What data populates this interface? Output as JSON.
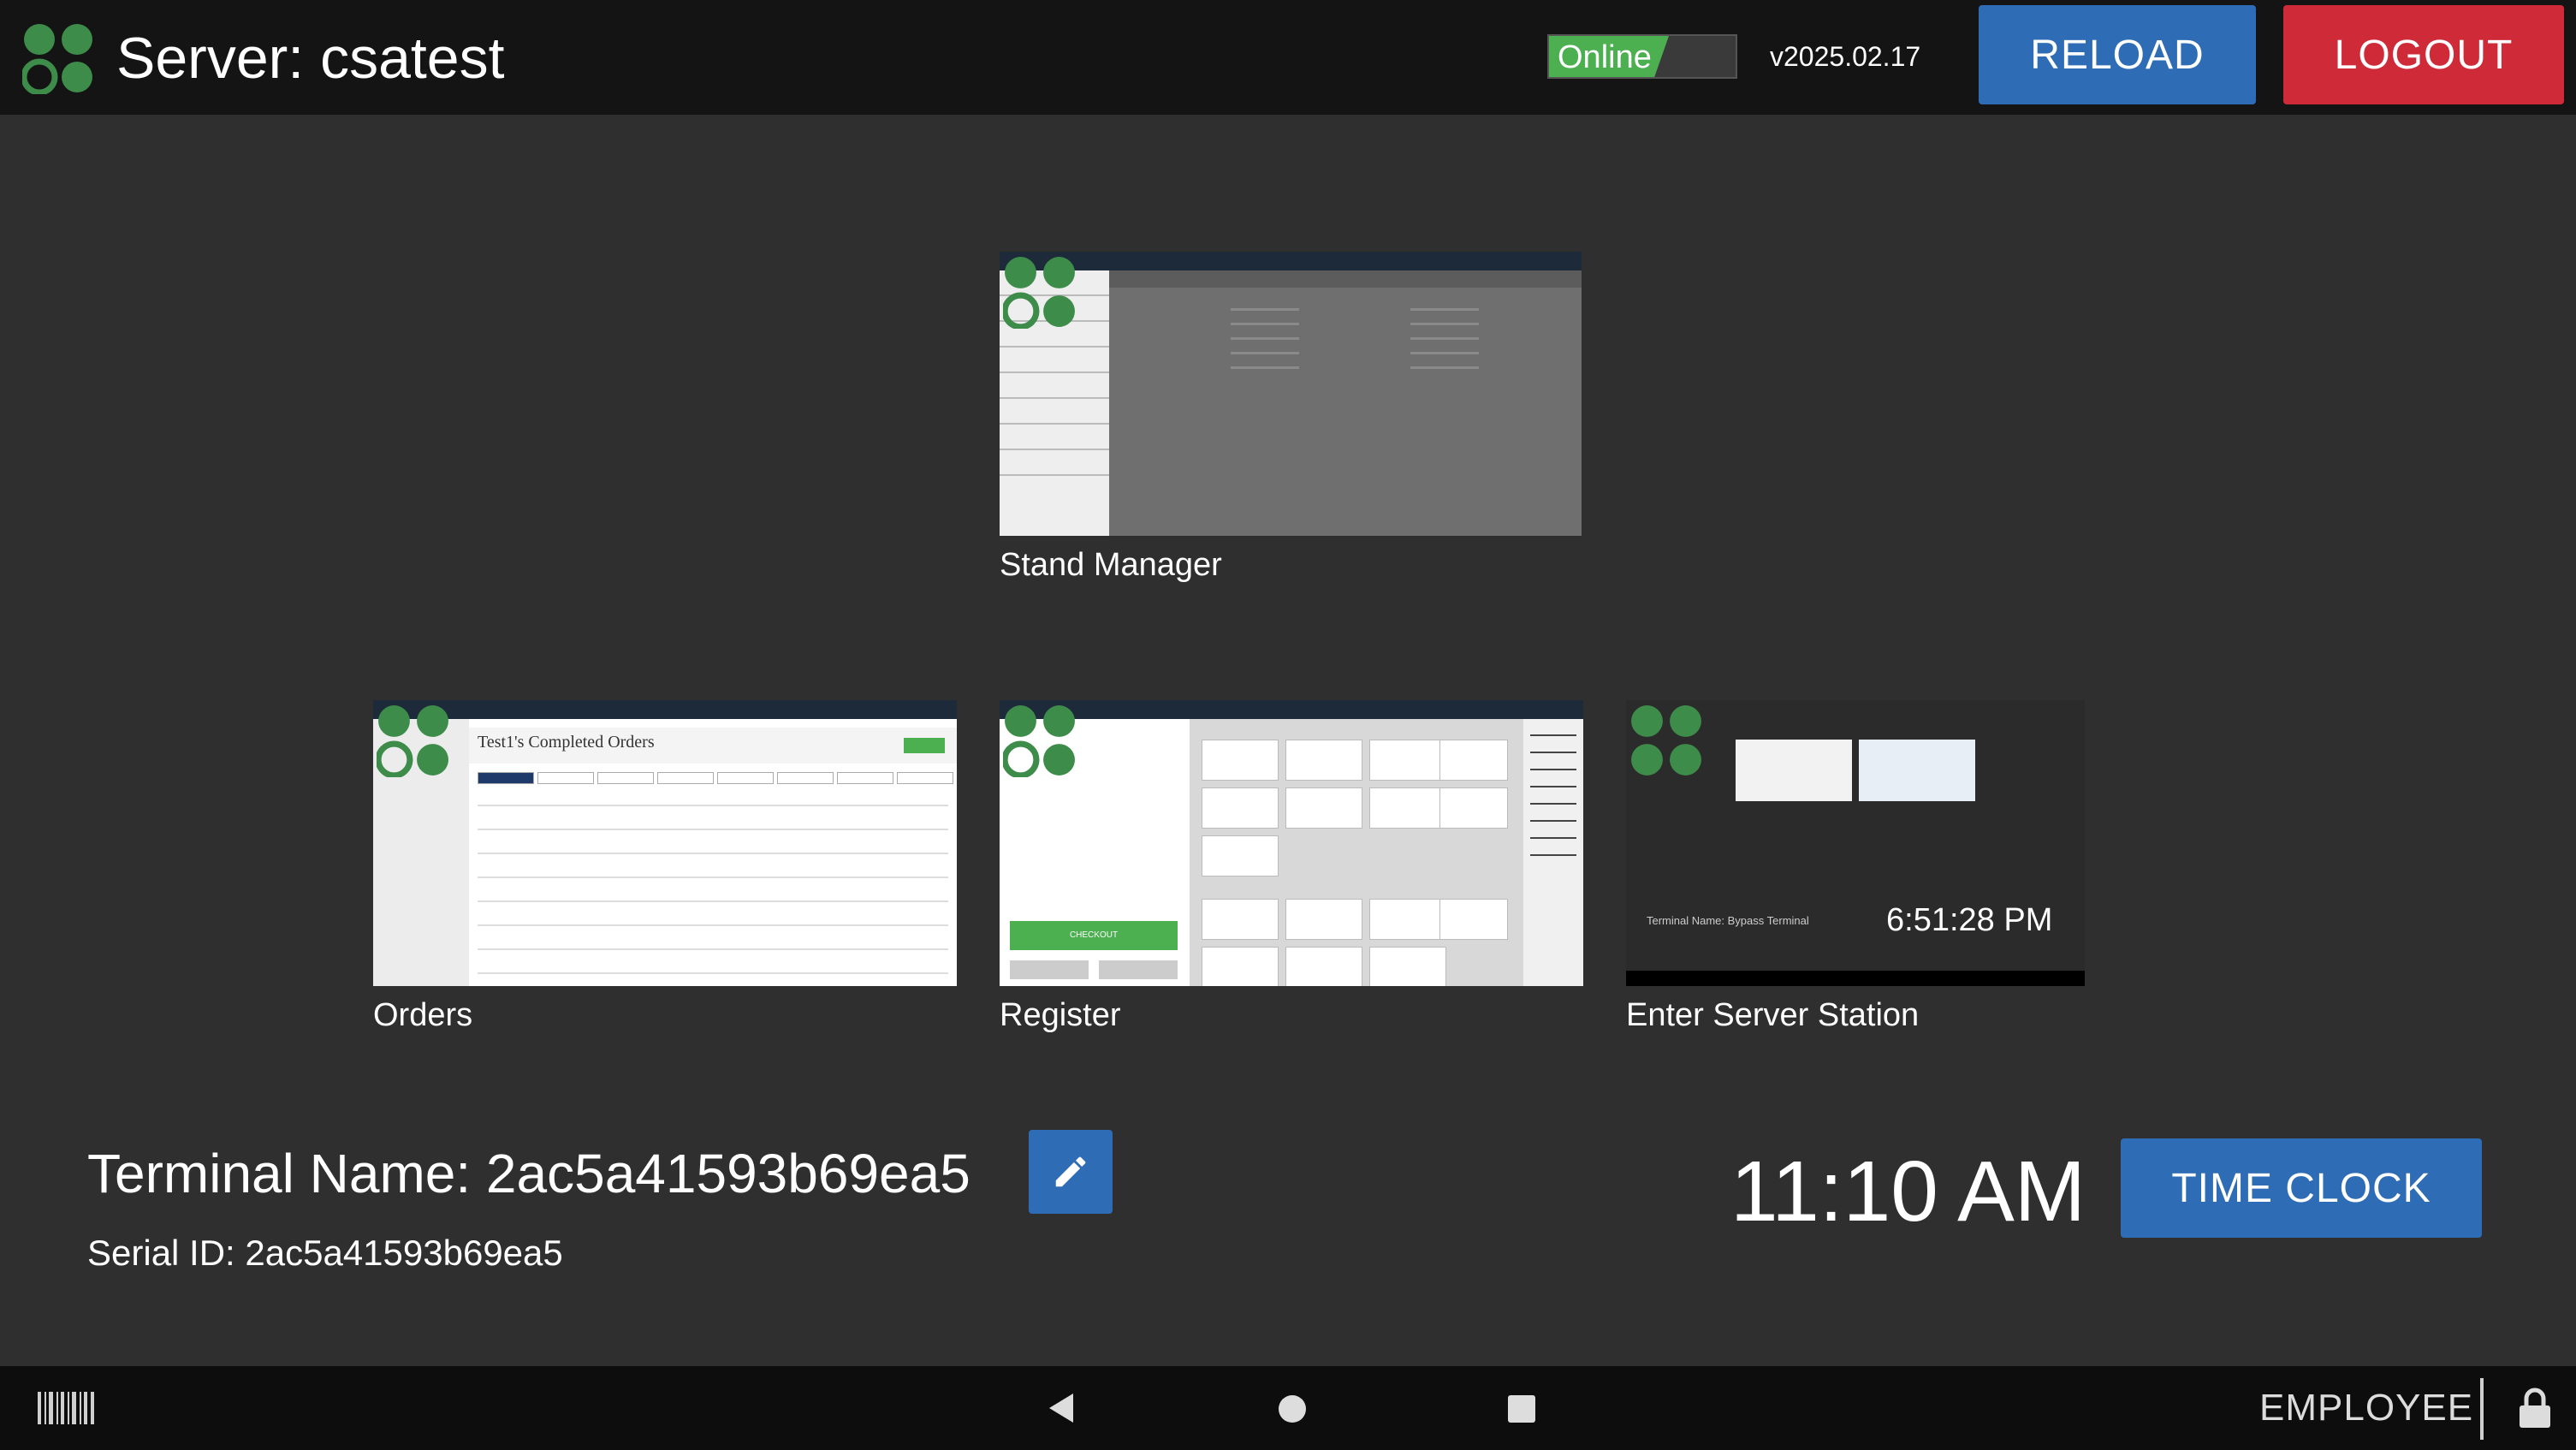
{
  "header": {
    "server_title": "Server: csatest",
    "status": "Online",
    "version": "v2025.02.17",
    "reload_label": "RELOAD",
    "logout_label": "LOGOUT"
  },
  "apps": {
    "stand_manager": {
      "label": "Stand Manager"
    },
    "orders": {
      "label": "Orders",
      "thumb_title": "Test1's Completed Orders"
    },
    "register": {
      "label": "Register",
      "thumb_checkout": "CHECKOUT"
    },
    "server_station": {
      "label": "Enter Server Station",
      "thumb_time": "6:51:28 PM",
      "thumb_terminal": "Terminal Name: Bypass Terminal"
    }
  },
  "terminal": {
    "name": "Terminal Name: 2ac5a41593b69ea5",
    "serial": "Serial ID: 2ac5a41593b69ea5"
  },
  "clock": {
    "time": "11:10 AM",
    "time_clock_label": "TIME CLOCK"
  },
  "navbar": {
    "mode_label": "EMPLOYEE"
  },
  "colors": {
    "primary_blue": "#2e6db5",
    "danger_red": "#cf2a37",
    "online_green": "#4caf50",
    "logo_green": "#3d8c4a",
    "background": "#2f2f2f",
    "header_bg": "#141414"
  },
  "icons": [
    "clover-logo-icon",
    "pencil-icon",
    "barcode-icon",
    "back-triangle-icon",
    "home-circle-icon",
    "recent-square-icon",
    "lock-icon"
  ]
}
